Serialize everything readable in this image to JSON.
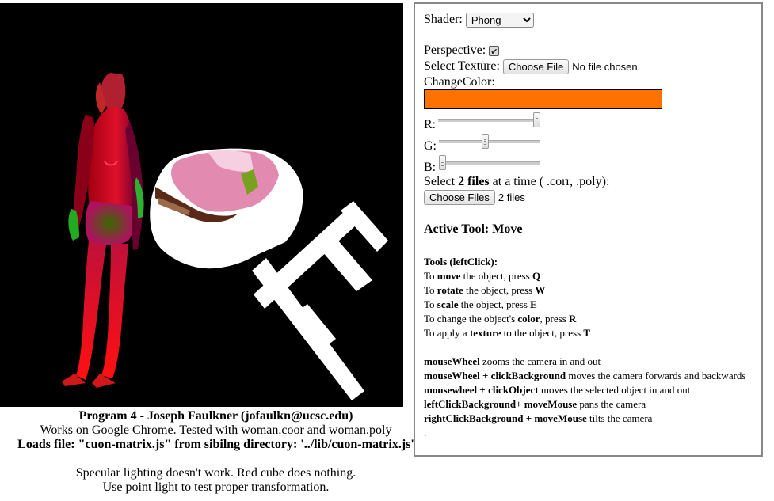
{
  "canvas": {
    "background": "#000000"
  },
  "caption": {
    "line1": "Program 4 - Joseph Faulkner (jofaulkn@ucsc.edu)",
    "line2": "Works on Google Chrome. Tested with woman.coor and woman.poly",
    "line3": "Loads file: \"cuon-matrix.js\" from sibilng directory: '../lib/cuon-matrix.js'",
    "line4": "Specular lighting doesn't work. Red cube does nothing.",
    "line5": "Use point light to test proper transformation."
  },
  "panel": {
    "shader_label": "Shader:",
    "shader_value": "Phong",
    "perspective_label": "Perspective:",
    "perspective_checked": true,
    "texture_label": "Select Texture:",
    "texture_button": "Choose File",
    "texture_status": "No file chosen",
    "change_color_label": "ChangeColor:",
    "color_value": "#ff7200",
    "sliders": {
      "r_label": "R:",
      "r_value": 1.0,
      "g_label": "G:",
      "g_value": 0.45,
      "b_label": "B:",
      "b_value": 0.0
    },
    "select_files_prefix": "Select",
    "select_files_bold": "2 files",
    "select_files_suffix": "at a time ( .corr, .poly):",
    "files_button": "Choose Files",
    "files_status": "2 files",
    "active_tool": "Active Tool: Move",
    "tools_header": "Tools (leftClick):",
    "tools": [
      {
        "pre": "To",
        "bold": "move",
        "mid": "the object, press",
        "key": "Q"
      },
      {
        "pre": "To",
        "bold": "rotate",
        "mid": "the object, press",
        "key": "W"
      },
      {
        "pre": "To",
        "bold": "scale",
        "mid": "the object, press",
        "key": "E"
      },
      {
        "pre": "To change the object's",
        "bold": "color",
        "mid": ", press",
        "key": "R"
      },
      {
        "pre": "To apply a",
        "bold": "texture",
        "mid": "to the object, press",
        "key": "T"
      }
    ],
    "mouse": [
      {
        "bold": "mouseWheel",
        "text": "zooms the camera in and out"
      },
      {
        "bold": "mouseWheel + clickBackground",
        "text": "moves the camera forwards and backwards"
      },
      {
        "bold": "mousewheel + clickObject",
        "text": "moves the selected object in and out"
      },
      {
        "bold": "leftClickBackground+ moveMouse",
        "text": "pans the camera"
      },
      {
        "bold": "rightClickBackground + moveMouse",
        "text": "tilts the camera"
      }
    ],
    "trailing_dot": "."
  }
}
